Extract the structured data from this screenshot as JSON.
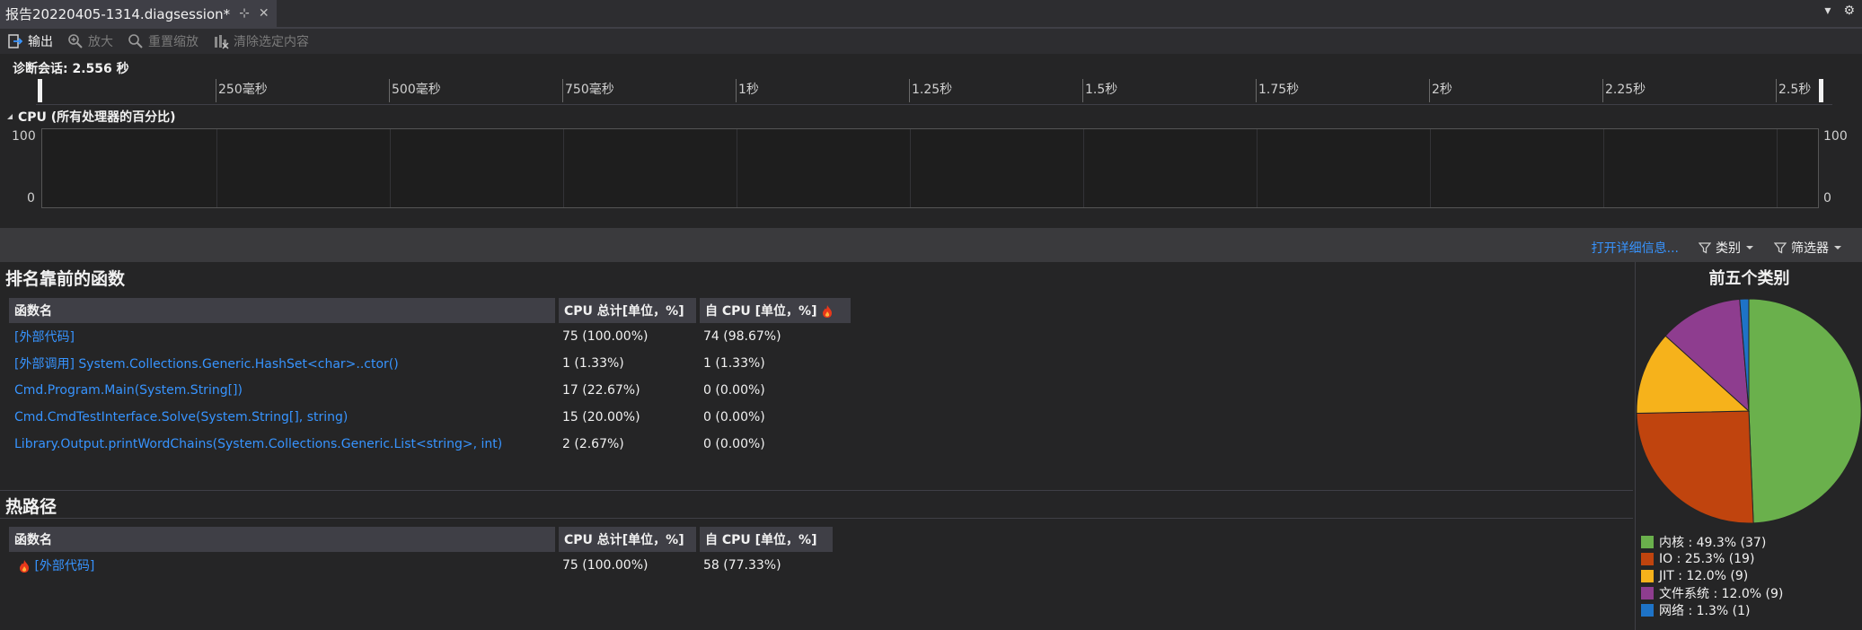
{
  "tab": {
    "title": "报告20220405-1314.diagsession*",
    "pin_glyph": "⊹",
    "close_glyph": "✕"
  },
  "tab_right": {
    "dropdown_glyph": "▾",
    "settings_glyph": "⚙"
  },
  "toolbar": {
    "output": "输出",
    "zoom_in": "放大",
    "reset_zoom": "重置缩放",
    "clear_selection": "清除选定内容"
  },
  "session": {
    "label": "诊断会话: 2.556 秒"
  },
  "ruler": {
    "ticks": [
      "250毫秒",
      "500毫秒",
      "750毫秒",
      "1秒",
      "1.25秒",
      "1.5秒",
      "1.75秒",
      "2秒",
      "2.25秒",
      "2.5秒"
    ]
  },
  "cpu": {
    "header": "CPU (所有处理器的百分比)",
    "y_max": "100",
    "y_min": "0"
  },
  "actions": {
    "details": "打开详细信息...",
    "category": "类别",
    "filter": "筛选器"
  },
  "top_functions": {
    "title": "排名靠前的函数",
    "headers": [
      "函数名",
      "CPU 总计[单位，%]",
      "自 CPU [单位，%]"
    ],
    "rows": [
      [
        "[外部代码]",
        "75 (100.00%)",
        "74 (98.67%)"
      ],
      [
        "[外部调用] System.Collections.Generic.HashSet<char>..ctor()",
        "1 (1.33%)",
        "1 (1.33%)"
      ],
      [
        "Cmd.Program.Main(System.String[])",
        "17 (22.67%)",
        "0 (0.00%)"
      ],
      [
        "Cmd.CmdTestInterface.Solve(System.String[], string)",
        "15 (20.00%)",
        "0 (0.00%)"
      ],
      [
        "Library.Output.printWordChains(System.Collections.Generic.List<string>, int)",
        "2 (2.67%)",
        "0 (0.00%)"
      ]
    ]
  },
  "hot_path": {
    "title": "热路径",
    "headers": [
      "函数名",
      "CPU 总计[单位，%]",
      "自 CPU [单位，%]"
    ],
    "rows": [
      [
        "[外部代码]",
        "75 (100.00%)",
        "58 (77.33%)"
      ]
    ]
  },
  "top_categories": {
    "title": "前五个类别",
    "items": [
      {
        "label": "内核 : 49.3% (37)",
        "value": 49.3,
        "color": "#6ab04c"
      },
      {
        "label": "IO : 25.3% (19)",
        "value": 25.3,
        "color": "#c0440e"
      },
      {
        "label": "JIT : 12.0% (9)",
        "value": 12.0,
        "color": "#f6b21b"
      },
      {
        "label": "文件系统 : 12.0% (9)",
        "value": 12.0,
        "color": "#8e3d8f"
      },
      {
        "label": "网络 : 1.3% (1)",
        "value": 1.3,
        "color": "#1e73c7"
      }
    ]
  }
}
